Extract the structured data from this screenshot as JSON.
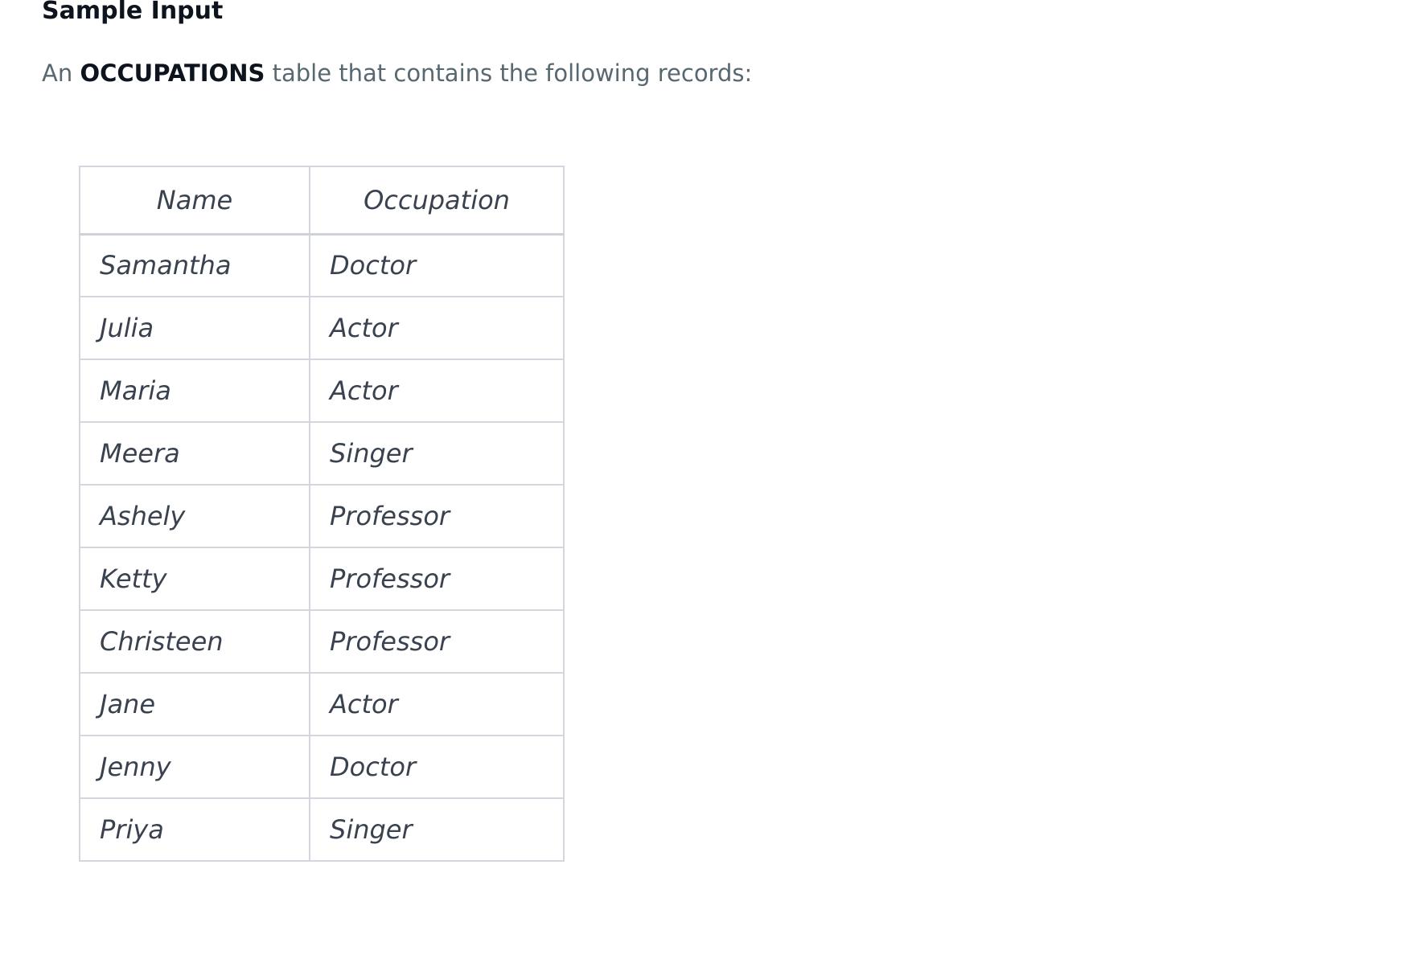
{
  "heading": "Sample Input",
  "intro": {
    "prefix": "An",
    "table_name": "OCCUPATIONS",
    "suffix": "table that contains the following records:"
  },
  "table": {
    "headers": [
      "Name",
      "Occupation"
    ],
    "rows": [
      [
        "Samantha",
        "Doctor"
      ],
      [
        "Julia",
        "Actor"
      ],
      [
        "Maria",
        "Actor"
      ],
      [
        "Meera",
        "Singer"
      ],
      [
        "Ashely",
        "Professor"
      ],
      [
        "Ketty",
        "Professor"
      ],
      [
        "Christeen",
        "Professor"
      ],
      [
        "Jane",
        "Actor"
      ],
      [
        "Jenny",
        "Doctor"
      ],
      [
        "Priya",
        "Singer"
      ]
    ]
  }
}
